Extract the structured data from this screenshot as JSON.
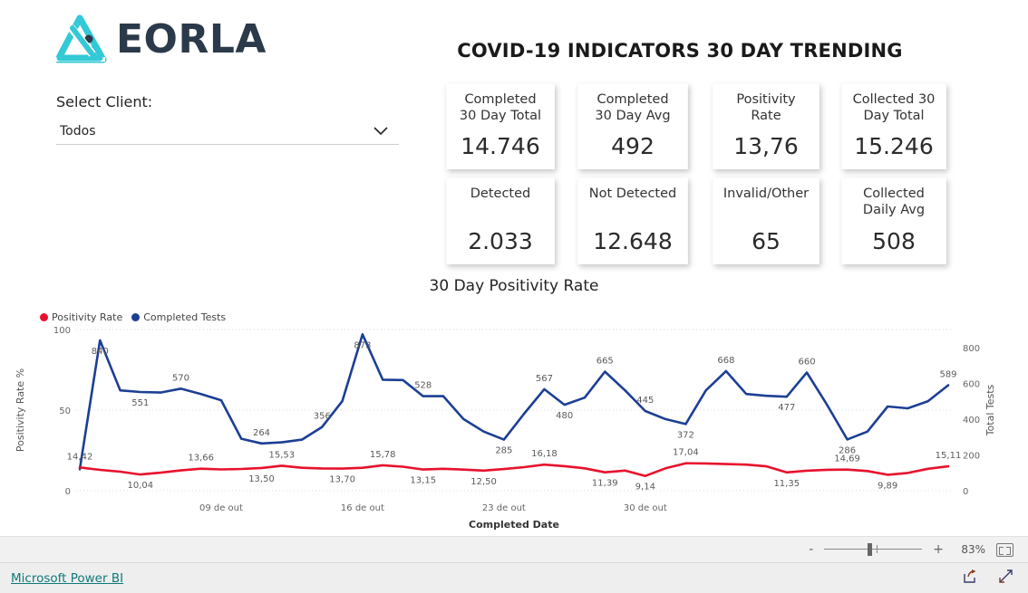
{
  "brand": {
    "wordmark": "EORLA",
    "logo_icon": "flask-triangle-logo",
    "logo_color": "#33c9d6",
    "wordmark_color": "#2b3a4a"
  },
  "header": {
    "title": "COVID-19 INDICATORS 30 DAY TRENDING"
  },
  "slicer": {
    "label": "Select Client:",
    "value": "Todos",
    "chevron_icon": "chevron-down-icon"
  },
  "kpis": [
    {
      "title": "Completed\n30 Day Total",
      "value": "14.746"
    },
    {
      "title": "Completed\n30 Day Avg",
      "value": "492"
    },
    {
      "title": "Positivity\nRate",
      "value": "13,76"
    },
    {
      "title": "Collected 30\nDay Total",
      "value": "15.246"
    },
    {
      "title": "Detected",
      "value": "2.033"
    },
    {
      "title": "Not Detected",
      "value": "12.648"
    },
    {
      "title": "Invalid/Other",
      "value": "65"
    },
    {
      "title": "Collected\nDaily Avg",
      "value": "508"
    }
  ],
  "status_bar": {
    "zoom_percent": "83%",
    "minus_label": "-",
    "plus_label": "+",
    "fit_icon": "fit-to-page-icon"
  },
  "footer": {
    "link_text": "Microsoft Power BI",
    "share_icon": "share-icon",
    "fullscreen_icon": "fullscreen-arrows-icon"
  },
  "chart_data": {
    "type": "line",
    "title": "30 Day Positivity Rate",
    "xlabel": "Completed Date",
    "ylabel": "Positivity Rate %",
    "y2label": "Total Tests",
    "ylim": [
      0,
      100
    ],
    "y2lim": [
      0,
      900
    ],
    "yticks": [
      0,
      50,
      100
    ],
    "y2ticks": [
      0,
      200,
      400,
      600,
      800
    ],
    "grid": true,
    "legend_position": "top-left",
    "x_tick_labels": [
      "09 de out",
      "16 de out",
      "23 de out",
      "30 de out"
    ],
    "x_tick_indices": [
      7,
      14,
      21,
      28
    ],
    "colors": {
      "positivity_rate": "#e8112d",
      "completed_tests": "#1c3f94"
    },
    "series": [
      {
        "name": "Positivity Rate",
        "axis": "left",
        "color": "#e8112d",
        "values": [
          14.42,
          12.9,
          11.8,
          10.04,
          11.2,
          12.6,
          13.66,
          13.2,
          13.5,
          14.1,
          15.53,
          14.2,
          13.8,
          13.7,
          14.2,
          15.78,
          14.9,
          13.15,
          13.6,
          13.1,
          12.5,
          13.4,
          14.6,
          16.18,
          15.2,
          13.9,
          11.39,
          12.5,
          9.14,
          13.9,
          17.04
        ],
        "labels": [
          {
            "index": 0,
            "text": "14,42",
            "pos": "above"
          },
          {
            "index": 3,
            "text": "10,04",
            "pos": "below"
          },
          {
            "index": 6,
            "text": "13,66",
            "pos": "above"
          },
          {
            "index": 9,
            "text": "13,50",
            "pos": "below"
          },
          {
            "index": 10,
            "text": "15,53",
            "pos": "above"
          },
          {
            "index": 13,
            "text": "13,70",
            "pos": "below"
          },
          {
            "index": 15,
            "text": "15,78",
            "pos": "above"
          },
          {
            "index": 17,
            "text": "13,15",
            "pos": "below"
          },
          {
            "index": 20,
            "text": "12,50",
            "pos": "below"
          },
          {
            "index": 23,
            "text": "16,18",
            "pos": "above"
          },
          {
            "index": 26,
            "text": "11,39",
            "pos": "below"
          },
          {
            "index": 28,
            "text": "9,14",
            "pos": "below"
          },
          {
            "index": 30,
            "text": "17,04",
            "pos": "above"
          }
        ]
      },
      {
        "name": "Completed Tests",
        "axis": "right",
        "color": "#1c3f94",
        "values": [
          120,
          840,
          560,
          551,
          548,
          570,
          540,
          505,
          290,
          264,
          270,
          285,
          356,
          500,
          873,
          620,
          618,
          528,
          528,
          400,
          330,
          285,
          430,
          567,
          480,
          520,
          665,
          560,
          445,
          400,
          372
        ],
        "labels": [
          {
            "index": 1,
            "text": "840",
            "pos": "below"
          },
          {
            "index": 3,
            "text": "551",
            "pos": "below"
          },
          {
            "index": 5,
            "text": "570",
            "pos": "above"
          },
          {
            "index": 9,
            "text": "264",
            "pos": "above"
          },
          {
            "index": 12,
            "text": "356",
            "pos": "above"
          },
          {
            "index": 14,
            "text": "873",
            "pos": "below"
          },
          {
            "index": 17,
            "text": "528",
            "pos": "above"
          },
          {
            "index": 21,
            "text": "285",
            "pos": "below"
          },
          {
            "index": 23,
            "text": "567",
            "pos": "above"
          },
          {
            "index": 24,
            "text": "480",
            "pos": "below"
          },
          {
            "index": 26,
            "text": "665",
            "pos": "above"
          },
          {
            "index": 28,
            "text": "445",
            "pos": "above"
          },
          {
            "index": 30,
            "text": "372",
            "pos": "below"
          }
        ]
      }
    ],
    "series_right_tail": {
      "positivity_extra": [
        16.9,
        16.5,
        16.2,
        15.1,
        11.35,
        12.4,
        13.0,
        13.1,
        12.2,
        9.89,
        11.0,
        13.6,
        15.11
      ],
      "completed_extra": [
        560,
        668,
        540,
        530,
        525,
        660,
        480,
        286,
        330,
        470,
        460,
        500,
        589
      ],
      "positivity_labels": [
        {
          "offset": 4,
          "text": "11,35",
          "pos": "below"
        },
        {
          "offset": 9,
          "text": "9,89",
          "pos": "below"
        },
        {
          "offset": 7,
          "text": "14,69",
          "pos": "above"
        },
        {
          "offset": 12,
          "text": "15,11",
          "pos": "above"
        }
      ],
      "completed_labels": [
        {
          "offset": 1,
          "text": "668",
          "pos": "above"
        },
        {
          "offset": 4,
          "text": "477",
          "pos": "below"
        },
        {
          "offset": 5,
          "text": "660",
          "pos": "above"
        },
        {
          "offset": 7,
          "text": "286",
          "pos": "below"
        },
        {
          "offset": 12,
          "text": "589",
          "pos": "above"
        }
      ]
    }
  }
}
